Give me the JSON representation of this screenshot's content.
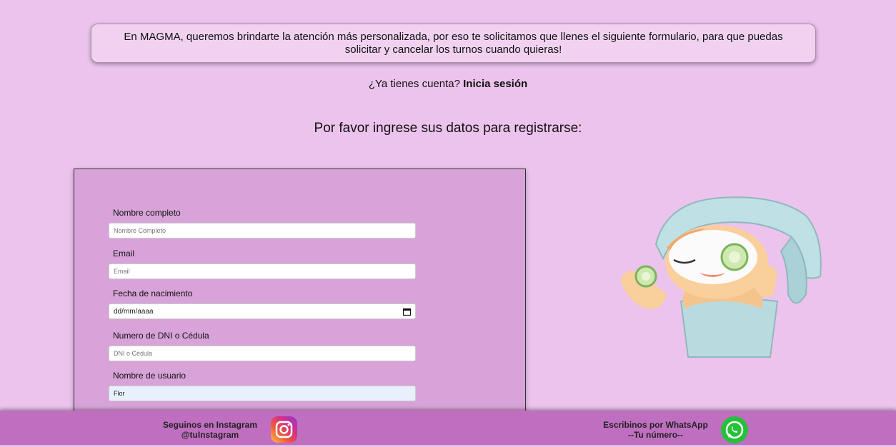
{
  "intro": {
    "text": "En MAGMA, queremos brindarte la atención más personalizada, por eso te solicitamos que llenes el siguiente formulario, para que puedas solicitar y cancelar los turnos cuando quieras!"
  },
  "login": {
    "prompt": "¿Ya tienes cuenta?",
    "link_label": "Inicia sesión"
  },
  "subtitle": "Por favor ingrese sus datos para registrarse:",
  "form": {
    "fields": [
      {
        "label": "Nombre completo",
        "placeholder": "Nombre Completo",
        "value": ""
      },
      {
        "label": "Email",
        "placeholder": "Email",
        "value": ""
      },
      {
        "label": "Fecha de nacimiento",
        "placeholder": "dd/mm/aaaa",
        "value": ""
      },
      {
        "label": "Numero de DNI o Cédula",
        "placeholder": "DNI o Cédula",
        "value": ""
      },
      {
        "label": "Nombre de usuario",
        "placeholder": "",
        "value": "Flor"
      }
    ]
  },
  "illustration": {
    "icon": "spa-woman-cucumber-mask-illustration"
  },
  "footer": {
    "instagram": {
      "line1": "Seguinos en Instagram",
      "line2": "@tuInstagram",
      "icon": "instagram-icon"
    },
    "whatsapp": {
      "line1": "Escribinos por WhatsApp",
      "line2": "--Tu número--",
      "icon": "whatsapp-icon"
    }
  },
  "colors": {
    "background": "#ecc3ec",
    "form_background": "#d8a3d8",
    "footer": "#c06fc0",
    "whatsapp_green": "#25c13a"
  }
}
